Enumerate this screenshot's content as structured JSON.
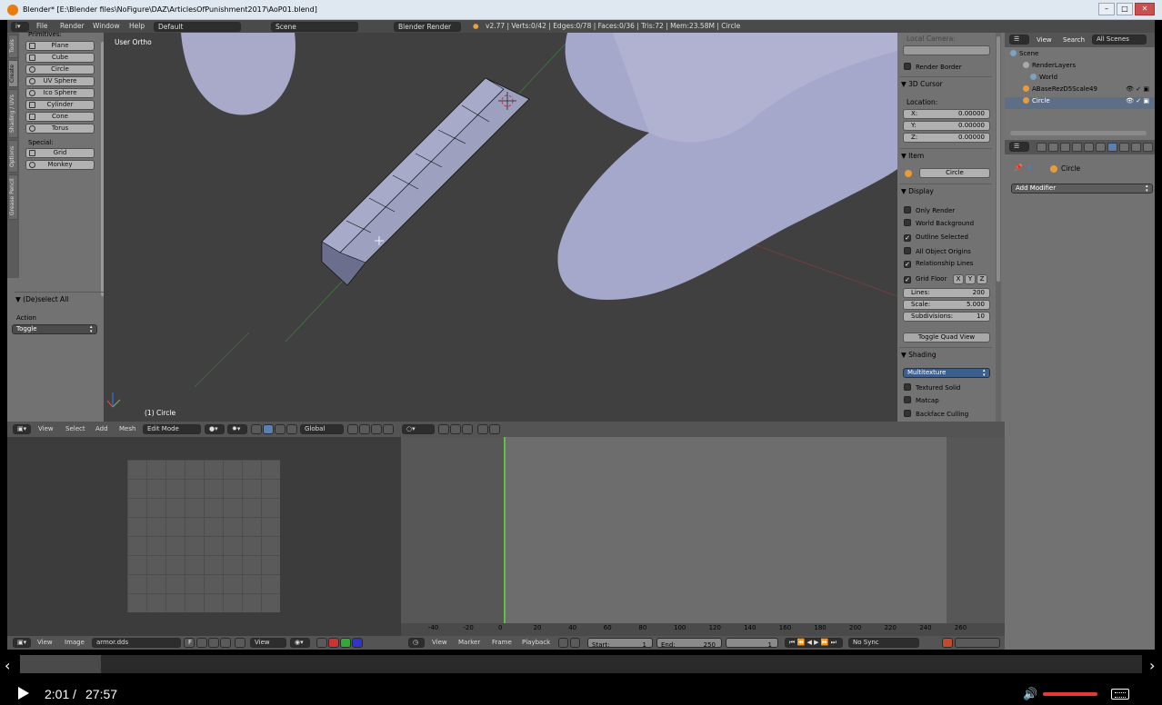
{
  "window": {
    "title": "Blender* [E:\\Blender files\\NoFigure\\DAZ\\ArticlesOfPunishment2017\\AoP01.blend]"
  },
  "info_header": {
    "menus": [
      "File",
      "Render",
      "Window",
      "Help"
    ],
    "screen_layout": "Default",
    "scene": "Scene",
    "render_engine": "Blender Render",
    "stats": "v2.77 | Verts:0/42 | Edges:0/78 | Faces:0/36 | Tris:72 | Mem:23.58M | Circle"
  },
  "toolshelf": {
    "tabs": [
      "Tools",
      "Create",
      "Shading / UVs",
      "Options",
      "Grease Pencil"
    ],
    "primitives_label": "Primitives:",
    "primitives": [
      "Plane",
      "Cube",
      "Circle",
      "UV Sphere",
      "Ico Sphere",
      "Cylinder",
      "Cone",
      "Torus"
    ],
    "special_label": "Special:",
    "special": [
      "Grid",
      "Monkey"
    ],
    "redo_title": "▼ (De)select All",
    "action_label": "Action",
    "action_value": "Toggle"
  },
  "viewport": {
    "view_label": "User Ortho",
    "object_label": "(1) Circle"
  },
  "npanel": {
    "local_camera": "Local Camera:",
    "render_border": "Render Border",
    "cursor_title": "▼ 3D Cursor",
    "location_label": "Location:",
    "cursor": [
      {
        "label": "X:",
        "value": "0.00000"
      },
      {
        "label": "Y:",
        "value": "0.00000"
      },
      {
        "label": "Z:",
        "value": "0.00000"
      }
    ],
    "item_title": "▼ Item",
    "item_name": "Circle",
    "display_title": "▼ Display",
    "display_checks": [
      {
        "label": "Only Render",
        "checked": false
      },
      {
        "label": "World Background",
        "checked": false
      },
      {
        "label": "Outline Selected",
        "checked": true
      },
      {
        "label": "All Object Origins",
        "checked": false
      },
      {
        "label": "Relationship Lines",
        "checked": true
      }
    ],
    "grid_floor": "Grid Floor",
    "axes": [
      "X",
      "Y",
      "Z"
    ],
    "grid": [
      {
        "label": "Lines:",
        "value": "200"
      },
      {
        "label": "Scale:",
        "value": "5.000"
      },
      {
        "label": "Subdivisions:",
        "value": "10"
      }
    ],
    "toggle_quad": "Toggle Quad View",
    "shading_title": "▼ Shading",
    "shading_mode": "Multitexture",
    "shading_checks": [
      "Textured Solid",
      "Matcap",
      "Backface Culling"
    ]
  },
  "outliner": {
    "menus": [
      "View",
      "Search"
    ],
    "filter": "All Scenes",
    "rows": [
      "Scene",
      "RenderLayers",
      "World",
      "ABaseRezD5Scale49",
      "Circle"
    ]
  },
  "properties": {
    "object_name": "Circle",
    "add_modifier": "Add Modifier"
  },
  "viewport_header": {
    "menus": [
      "View",
      "Select",
      "Add",
      "Mesh"
    ],
    "mode": "Edit Mode",
    "orientation": "Global"
  },
  "image_editor_header": {
    "menus": [
      "View",
      "Image"
    ],
    "image_name": "armor.dds",
    "f_label": "F",
    "view": "View"
  },
  "timeline": {
    "ticks": [
      "-40",
      "-20",
      "0",
      "20",
      "40",
      "60",
      "80",
      "100",
      "120",
      "140",
      "160",
      "180",
      "200",
      "220",
      "240",
      "260"
    ],
    "menus": [
      "View",
      "Marker",
      "Frame",
      "Playback"
    ],
    "start": "Start:",
    "start_value": "1",
    "end": "End:",
    "end_value": "250",
    "current": "1",
    "sync": "No Sync"
  },
  "player": {
    "current_time": "2:01",
    "separator": "/",
    "duration": "27:57",
    "progress": 0.072,
    "volume": 0.85,
    "colors": {
      "volume": "#e53935",
      "timeline_cursor": "#60c040"
    }
  }
}
